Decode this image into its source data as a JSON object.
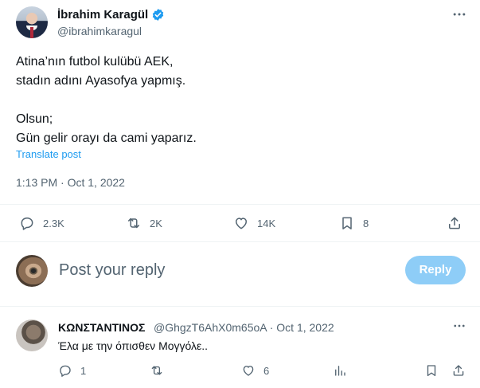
{
  "tweet": {
    "author_name": "İbrahim Karagül",
    "author_handle": "@ibrahimkaragul",
    "verified": true,
    "text_lines": [
      "Atina’nın futbol kulübü AEK,",
      "stadın adını Ayasofya yapmış.",
      "",
      "Olsun;",
      "Gün gelir orayı da cami yaparız."
    ],
    "translate_label": "Translate post",
    "timestamp": "1:13 PM · Oct 1, 2022",
    "more_icon": "more-horizontal-icon",
    "stats": {
      "replies": "2.3K",
      "reposts": "2K",
      "likes": "14K",
      "bookmarks": "8"
    }
  },
  "composer": {
    "placeholder": "Post your reply",
    "reply_label": "Reply"
  },
  "reply": {
    "author_name": "ΚΩΝΣΤΑΝΤΙΝΟΣ",
    "author_handle_time": "@GhgzT6AhX0m65oA · Oct 1, 2022",
    "text": "Έλα με την όπισθεν Μογγόλε..",
    "stats": {
      "replies": "1",
      "likes": "6"
    }
  },
  "colors": {
    "accent": "#1d9bf0",
    "reply_button_disabled": "#8ecdf7",
    "secondary_text": "#536471",
    "divider": "#eff3f4"
  }
}
